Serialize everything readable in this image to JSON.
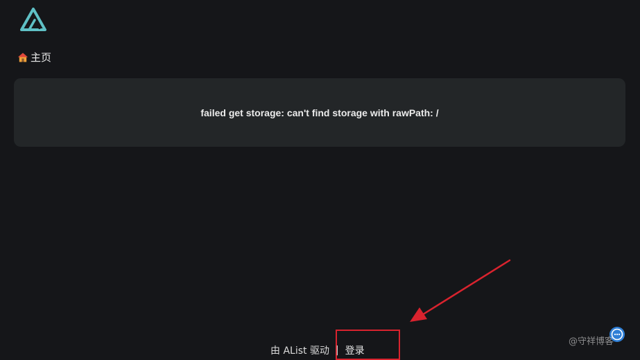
{
  "breadcrumb": {
    "home_label": "主页"
  },
  "error": {
    "message": "failed get storage: can't find storage with rawPath: /"
  },
  "footer": {
    "powered_by": "由 AList 驱动",
    "separator": "|",
    "login_label": "登录"
  },
  "watermark": {
    "text": "@守祥博客"
  },
  "colors": {
    "background": "#151619",
    "card": "#232628",
    "logo_accent": "#5fc0c5",
    "annotation_red": "#d9232e",
    "fab_blue": "#2f7fd6"
  },
  "icons": {
    "logo": "alist-logo-icon",
    "home": "house-icon",
    "chat": "chat-bubble-icon"
  }
}
